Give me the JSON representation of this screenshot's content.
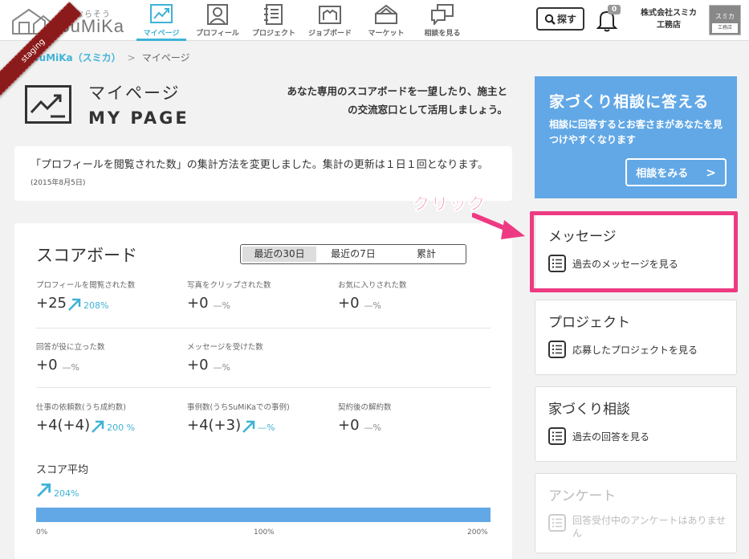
{
  "header": {
    "logo_tagline": "素敵ならそう",
    "logo_brand": "SuMiKa",
    "nav": [
      {
        "label": "マイページ",
        "icon": "chart-icon",
        "active": true
      },
      {
        "label": "プロフィール",
        "icon": "person-icon",
        "active": false
      },
      {
        "label": "プロジェクト",
        "icon": "notebook-icon",
        "active": false
      },
      {
        "label": "ジョブボード",
        "icon": "board-icon",
        "active": false
      },
      {
        "label": "マーケット",
        "icon": "tent-icon",
        "active": false
      },
      {
        "label": "相談を見る",
        "icon": "chat-icon",
        "active": false
      }
    ],
    "search_label": "探す",
    "notification_count": "0",
    "company_name": "株式会社スミカ工務店",
    "avatar_top": "スミカ",
    "avatar_bottom": "工務店",
    "staging_ribbon": "staging"
  },
  "breadcrumb": {
    "home": "SuMiKa（スミカ）",
    "current": "マイページ"
  },
  "page": {
    "title_ja": "マイページ",
    "title_en": "MY PAGE",
    "lead": "あなた専用のスコアボードを一望したり、施主との交流窓口として活用しましょう。"
  },
  "notice": {
    "text": "「プロフィールを閲覧された数」の集計方法を変更しました。集計の更新は１日１回となります。",
    "date": "(2015年8月5日)"
  },
  "scoreboard": {
    "title": "スコアボード",
    "tabs": [
      "最近の30日",
      "最近の7日",
      "累計"
    ],
    "metrics": [
      {
        "label": "プロフィールを閲覧された数",
        "value": "+25",
        "pct": "208%",
        "up": true
      },
      {
        "label": "写真をクリップされた数",
        "value": "+0",
        "pct": "—%",
        "up": false
      },
      {
        "label": "お気に入りされた数",
        "value": "+0",
        "pct": "—%",
        "up": false
      },
      {
        "label": "回答が役に立った数",
        "value": "+0",
        "pct": "—%",
        "up": false
      },
      {
        "label": "メッセージを受けた数",
        "value": "+0",
        "pct": "—%",
        "up": false
      },
      {
        "label": "仕事の依頼数(うち成約数)",
        "value": "+4(+4)",
        "pct": "200 %",
        "up": true
      },
      {
        "label": "事例数(うちSuMiKaでの事例)",
        "value": "+4(+3)",
        "pct": "—%",
        "up": true
      },
      {
        "label": "契約後の解約数",
        "value": "+0",
        "pct": "—%",
        "up": false
      }
    ],
    "avg_title": "スコア平均",
    "avg_pct": "204%",
    "avg_ticks": [
      "0%",
      "100%",
      "200%"
    ]
  },
  "sidebar": {
    "banner_title": "家づくり相談に答える",
    "banner_body": "相談に回答するとお客さまがあなたを見つけやすくなります",
    "banner_button": "相談をみる",
    "cards": [
      {
        "title": "メッセージ",
        "link": "過去のメッセージを見る"
      },
      {
        "title": "プロジェクト",
        "link": "応募したプロジェクトを見る"
      },
      {
        "title": "家づくり相談",
        "link": "過去の回答を見る"
      },
      {
        "title": "アンケート",
        "link": "回答受付中のアンケートはありません"
      }
    ]
  },
  "annotation": {
    "click_label": "クリック"
  },
  "colors": {
    "accent": "#3eb3d6",
    "banner": "#62a8e6",
    "highlight": "#ee3a82",
    "staging": "#8b1a1a"
  }
}
